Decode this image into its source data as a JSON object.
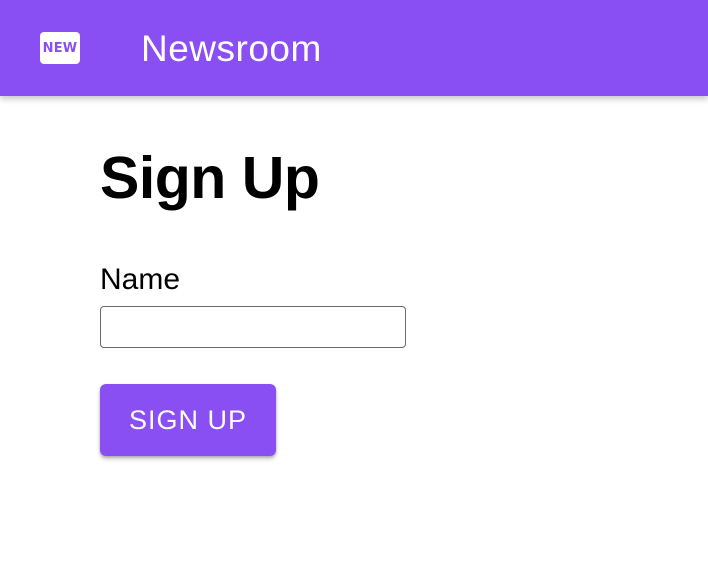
{
  "header": {
    "logo_text": "NEW",
    "title": "Newsroom",
    "background_color": "#8a4ff3"
  },
  "main": {
    "title": "Sign Up",
    "form": {
      "name_label": "Name",
      "name_value": "",
      "submit_label": "SIGN UP"
    }
  }
}
